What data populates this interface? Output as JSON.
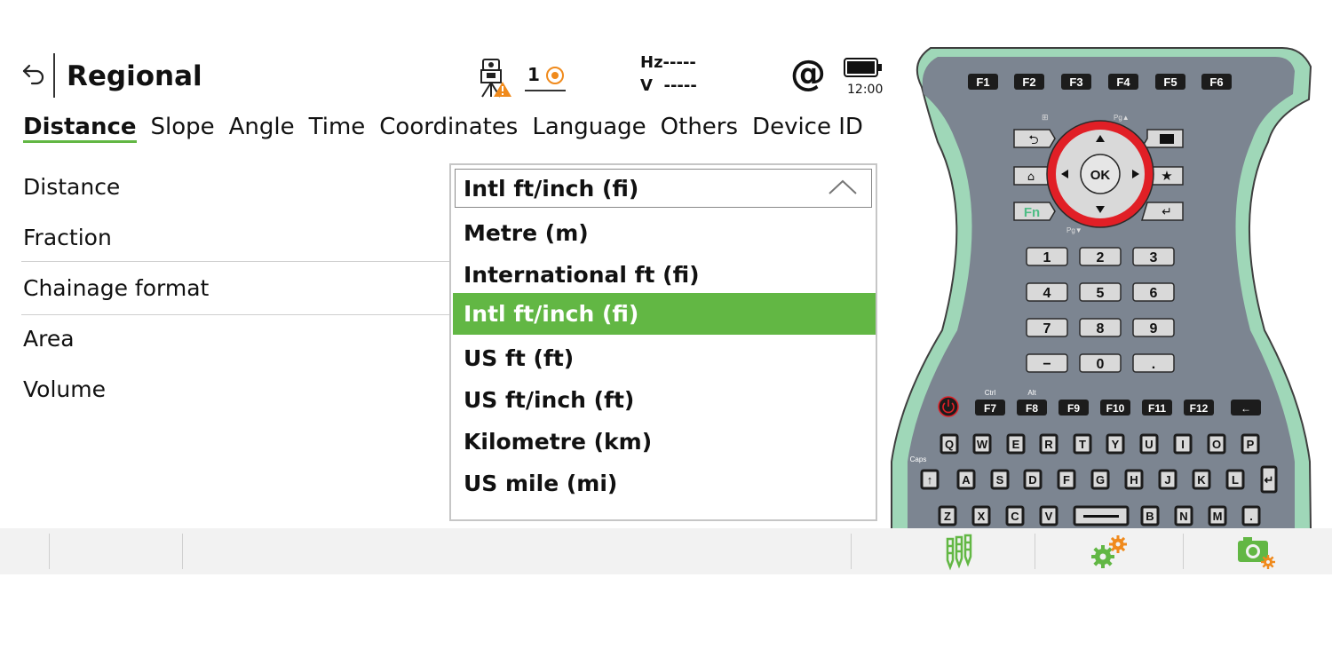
{
  "header": {
    "title": "Regional",
    "target_count": "1",
    "hz_label": "Hz",
    "hz_value": "-----",
    "v_label": "V",
    "v_value": "-----",
    "at_symbol": "@",
    "time": "12:00"
  },
  "tabs": [
    {
      "label": "Distance",
      "active": true
    },
    {
      "label": "Slope"
    },
    {
      "label": "Angle"
    },
    {
      "label": "Time"
    },
    {
      "label": "Coordinates"
    },
    {
      "label": "Language"
    },
    {
      "label": "Others"
    },
    {
      "label": "Device ID"
    }
  ],
  "settings": [
    {
      "label": "Distance"
    },
    {
      "label": "Fraction"
    },
    {
      "label": "Chainage format"
    },
    {
      "label": "Area"
    },
    {
      "label": "Volume"
    }
  ],
  "dropdown": {
    "selected": "Intl ft/inch (fi)",
    "options": [
      "Metre (m)",
      "International ft (fi)",
      "Intl ft/inch (fi)",
      "US ft (ft)",
      "US ft/inch (ft)",
      "Kilometre (km)",
      "US mile (mi)"
    ],
    "highlighted_index": 2
  },
  "keypad": {
    "function_keys": [
      "F1",
      "F2",
      "F3",
      "F4",
      "F5",
      "F6"
    ],
    "ok_label": "OK",
    "fn_label": "Fn",
    "pg_up_label": "Pg▲",
    "pg_down_label": "Pg▼",
    "number_rows": [
      [
        "1",
        "2",
        "3"
      ],
      [
        "4",
        "5",
        "6"
      ],
      [
        "7",
        "8",
        "9"
      ],
      [
        "−",
        "0",
        "."
      ]
    ],
    "lower_function_keys": [
      "F7",
      "F8",
      "F9",
      "F10",
      "F11",
      "F12"
    ],
    "ctrl_label": "Ctrl",
    "alt_label": "Alt",
    "caps_label": "Caps",
    "letter_rows": [
      [
        "Q",
        "W",
        "E",
        "R",
        "T",
        "Y",
        "U",
        "I",
        "O",
        "P"
      ],
      [
        "A",
        "S",
        "D",
        "F",
        "G",
        "H",
        "J",
        "K",
        "L"
      ],
      [
        "Z",
        "X",
        "C",
        "V",
        "B",
        "N",
        "M",
        "."
      ]
    ]
  },
  "bottom_bar": {
    "icons": [
      "survey-stakes-icon",
      "settings-gears-icon",
      "camera-settings-icon"
    ]
  },
  "colors": {
    "accent": "#62b744",
    "ring_red": "#e11f26",
    "keypad_body": "#7c8591",
    "keypad_trim": "#9fd7b8",
    "gear_orange": "#f08a1c"
  }
}
